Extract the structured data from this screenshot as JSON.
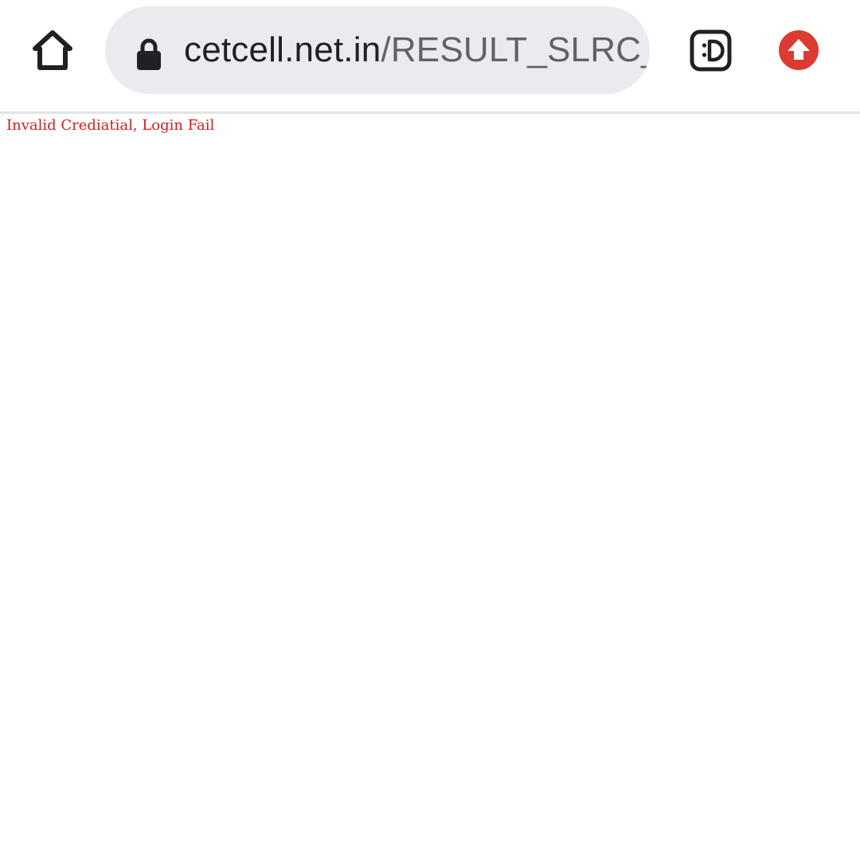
{
  "browser": {
    "omnibox": {
      "url_host": "cetcell.net.in",
      "url_path": "/RESULT_SLRC_"
    },
    "icons": {
      "home": "home-icon",
      "lock": "lock-icon",
      "extension": "smiley-extension-icon",
      "update": "update-arrow-icon"
    },
    "colors": {
      "omnibox_bg": "#eaebee",
      "update_badge": "#db3b31",
      "error_text": "#d31d1d"
    }
  },
  "page": {
    "error_message": "Invalid Crediatial, Login Fail"
  }
}
